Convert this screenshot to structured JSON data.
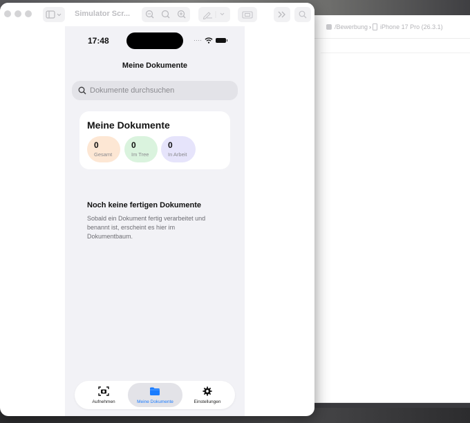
{
  "simulator": {
    "window_title": "Simulator Scr...",
    "toolbar_icons": [
      "sidebar-toggle-icon",
      "chevron-down-icon",
      "zoom-out-icon",
      "zoom-actual-icon",
      "zoom-in-icon",
      "markup-pen-icon",
      "chevron-down-icon",
      "screenshot-icon",
      "more-icon",
      "search-icon"
    ]
  },
  "xcode": {
    "breadcrumb_scheme": "/Bewerbung",
    "breadcrumb_device": "iPhone 17 Pro (26.3.1)"
  },
  "device": {
    "status": {
      "time": "17:48"
    },
    "nav_title": "Meine Dokumente",
    "search": {
      "placeholder": "Dokumente durchsuchen"
    },
    "summary": {
      "title": "Meine Dokumente",
      "stats": [
        {
          "value": "0",
          "label": "Gesamt",
          "color": "#fde7d4"
        },
        {
          "value": "0",
          "label": "Im Tree",
          "color": "#daf3de"
        },
        {
          "value": "0",
          "label": "In Arbeit",
          "color": "#e6e4fb"
        }
      ]
    },
    "empty_state": {
      "title": "Noch keine fertigen Dokumente",
      "text": "Sobald ein Dokument fertig verarbeitet und benannt ist, erscheint es hier im Dokumentbaum."
    },
    "tabs": [
      {
        "label": "Aufnehmen",
        "icon": "camera-viewfinder-icon",
        "active": false
      },
      {
        "label": "Meine Dokumente",
        "icon": "folder-icon",
        "active": true
      },
      {
        "label": "Einstellungen",
        "icon": "gear-icon",
        "active": false
      }
    ],
    "accent_color": "#1a7cff"
  }
}
